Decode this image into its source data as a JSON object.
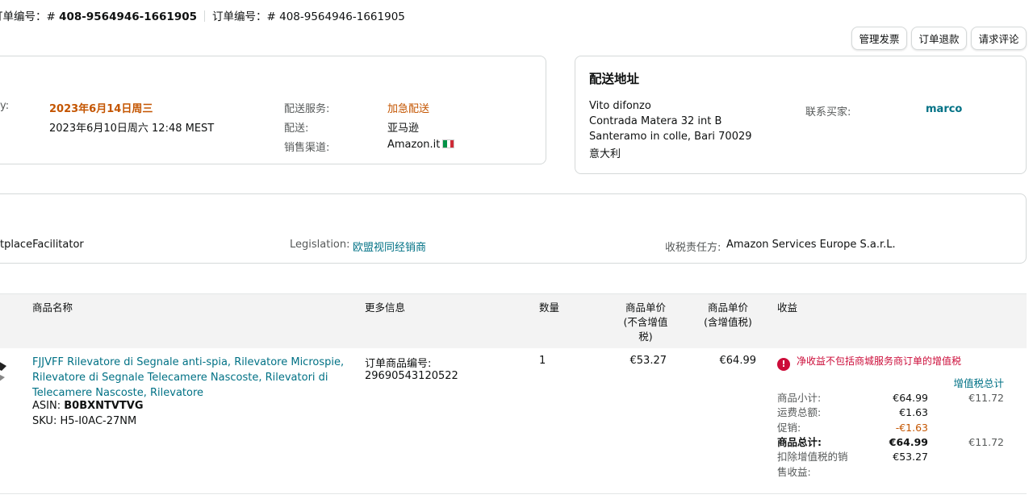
{
  "header": {
    "order_id_label": "订单编号：",
    "order_id_prefix": "# ",
    "order_id": "408-9564946-1661905",
    "order_id2_label": "订单编号：",
    "order_id2": "# 408-9564946-1661905"
  },
  "actions": {
    "manage_invoice": "管理发票",
    "refund_order": "订单退款",
    "request_review": "请求评论"
  },
  "summary": {
    "deliver_by_label": "y:",
    "deliver_by_value": "2023年6月14日周三",
    "purchase_date": "2023年6月10日周六 12:48 MEST",
    "shipping_service_label": "配送服务:",
    "shipping_service_value": "加急配送",
    "fulfillment_label": "配送:",
    "fulfillment_value": "亚马逊",
    "sales_channel_label": "销售渠道:",
    "sales_channel_value": "Amazon.it"
  },
  "shipping_address": {
    "title": "配送地址",
    "name": "Vito difonzo",
    "line1": "Contrada Matera 32 int B",
    "line2": "Santeramo in colle, Bari 70029",
    "country": "意大利",
    "contact_label": "联系买家:",
    "contact_value": "marco"
  },
  "tax": {
    "model_value": "tplaceFacilitator",
    "legislation_label": "Legislation:",
    "legislation_value": "欧盟视同经销商",
    "collector_label": "收税责任方:",
    "collector_value": "Amazon Services Europe S.a.r.L."
  },
  "table": {
    "col_name": "商品名称",
    "col_more": "更多信息",
    "col_qty": "数量",
    "col_unit_excl_line1": "商品单价",
    "col_unit_excl_line2": "(不含增值",
    "col_unit_excl_line3": "税)",
    "col_unit_incl_line1": "商品单价",
    "col_unit_incl_line2": "(含增值税)",
    "col_proceeds": "收益"
  },
  "item": {
    "title_line1": "FJJVFF Rilevatore di Segnale anti-spia, Rilevatore Microspie,",
    "title_line2": "Rilevatore di Segnale Telecamere Nascoste, Rilevatori di",
    "title_line3": "Telecamere Nascoste, Rilevatore",
    "asin_label": "ASIN:",
    "asin": "B0BXNTVTVG",
    "sku_label": "SKU:",
    "sku": "H5-I0AC-27NM",
    "order_item_label": "订单商品编号:",
    "order_item_id": "29690543120522",
    "quantity": "1",
    "unit_price_excl": "€53.27",
    "unit_price_incl": "€64.99"
  },
  "proceeds": {
    "warning": "净收益不包括商城服务商订单的增值税",
    "vat_total_header": "增值税总计",
    "subtotal_label": "商品小计:",
    "subtotal": "€64.99",
    "subtotal_vat": "€11.72",
    "shipping_label": "运费总额:",
    "shipping": "€1.63",
    "promo_label": "促销:",
    "promo": "-€1.63",
    "total_label": "商品总计:",
    "total": "€64.99",
    "total_vat": "€11.72",
    "net_label_line1": "扣除增值税的销",
    "net_label_line2": "售收益:",
    "net": "€53.27"
  },
  "colors": {
    "link": "#007185",
    "accent_orange": "#c45500",
    "alert_red": "#cc0c39"
  }
}
